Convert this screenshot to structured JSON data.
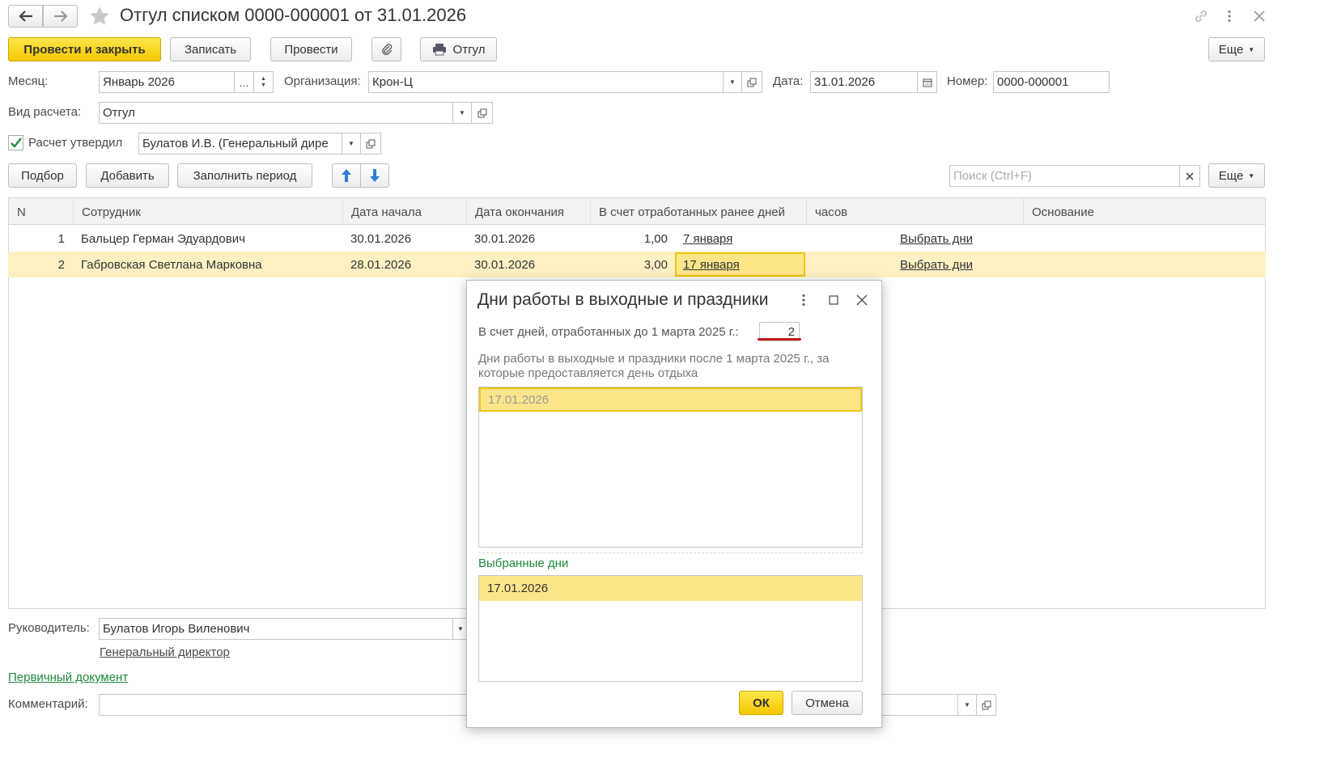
{
  "window": {
    "title": "Отгул списком 0000-000001 от 31.01.2026"
  },
  "toolbar": {
    "post_close": "Провести и закрыть",
    "save": "Записать",
    "post": "Провести",
    "print": "Отгул",
    "more": "Еще"
  },
  "form": {
    "month_label": "Месяц:",
    "month_value": "Январь 2026",
    "month_dots": "...",
    "org_label": "Организация:",
    "org_value": "Крон-Ц",
    "date_label": "Дата:",
    "date_value": "31.01.2026",
    "number_label": "Номер:",
    "number_value": "0000-000001",
    "calc_type_label": "Вид расчета:",
    "calc_type_value": "Отгул",
    "approved_label": "Расчет утвердил",
    "approved_value": "Булатов И.В. (Генеральный дире"
  },
  "table_toolbar": {
    "select": "Подбор",
    "add": "Добавить",
    "fill_period": "Заполнить период",
    "search_placeholder": "Поиск (Ctrl+F)",
    "more": "Еще"
  },
  "table": {
    "columns": [
      "N",
      "Сотрудник",
      "Дата начала",
      "Дата окончания",
      "В счет отработанных ранее дней",
      "часов",
      "Основание"
    ],
    "rows": [
      {
        "n": "1",
        "employee": "Бальцер Герман Эдуардович",
        "start": "30.01.2026",
        "end": "30.01.2026",
        "days": "1,00",
        "days_link": "7 января",
        "hours_link": "Выбрать дни"
      },
      {
        "n": "2",
        "employee": "Габровская Светлана Марковна",
        "start": "28.01.2026",
        "end": "30.01.2026",
        "days": "3,00",
        "days_link": "17 января",
        "hours_link": "Выбрать дни"
      }
    ]
  },
  "footer": {
    "manager_label": "Руководитель:",
    "manager_value": "Булатов Игорь Виленович",
    "manager_position": "Генеральный директор",
    "primary_doc": "Первичный документ",
    "comment_label": "Комментарий:"
  },
  "dialog": {
    "title": "Дни работы в выходные и праздники",
    "before_label": "В счет дней, отработанных до 1 марта 2025 г.:",
    "before_value": "2",
    "after_label": "Дни работы в выходные и праздники после 1 марта 2025 г., за которые предоставляется день отдыха",
    "after_items": [
      "17.01.2026"
    ],
    "selected_label": "Выбранные дни",
    "selected_items": [
      "17.01.2026"
    ],
    "ok": "ОК",
    "cancel": "Отмена"
  },
  "colors": {
    "accent_yellow": "#f4c800",
    "row_highlight": "#fdf1c4",
    "selected_item": "#fde68a",
    "link_green": "#1e8a3c",
    "underline_red": "#c0161c"
  }
}
